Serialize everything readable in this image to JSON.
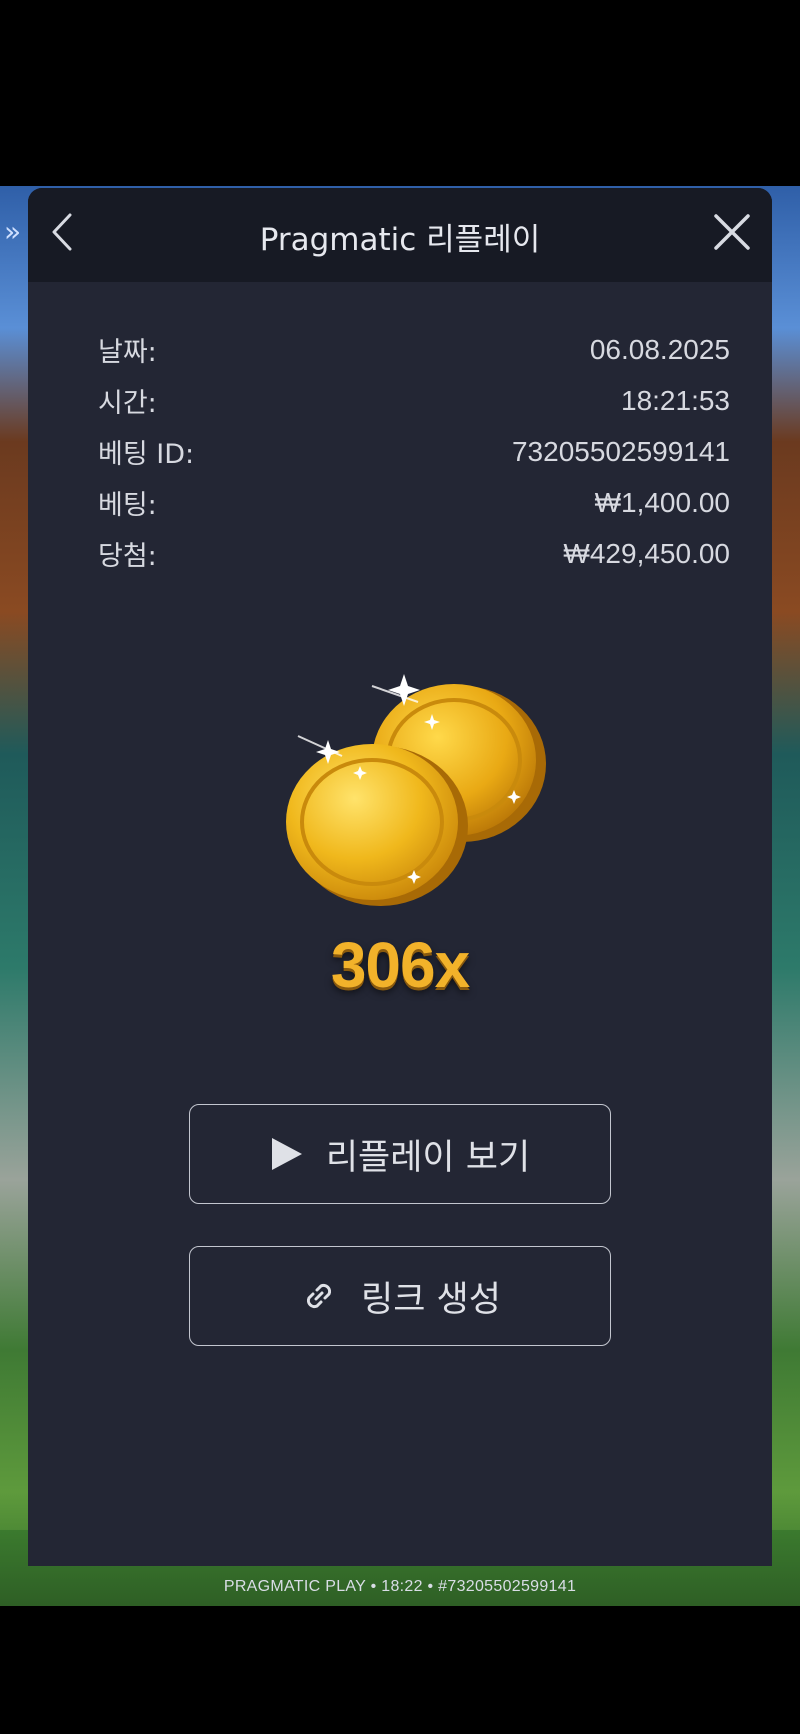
{
  "modal": {
    "title": "Pragmatic 리플레이"
  },
  "details": [
    {
      "label": "날짜:",
      "value": "06.08.2025"
    },
    {
      "label": "시간:",
      "value": "18:21:53"
    },
    {
      "label": "베팅 ID:",
      "value": "73205502599141"
    },
    {
      "label": "베팅:",
      "value": "₩1,400.00"
    },
    {
      "label": "당첨:",
      "value": "₩429,450.00"
    }
  ],
  "win": {
    "multiplier": "306x"
  },
  "buttons": {
    "replay_label": "리플레이 보기",
    "link_label": "링크 생성"
  },
  "footer": {
    "text": "PRAGMATIC PLAY • 18:22 • #73205502599141"
  },
  "icons": {
    "back": "chevron-left-icon",
    "close": "close-icon",
    "replay": "play-icon",
    "link": "link-icon",
    "side": "double-chevron-right-icon"
  },
  "colors": {
    "modal_bg": "#232634",
    "header_bg": "#171a24",
    "accent_gold": "#f2b22a"
  }
}
